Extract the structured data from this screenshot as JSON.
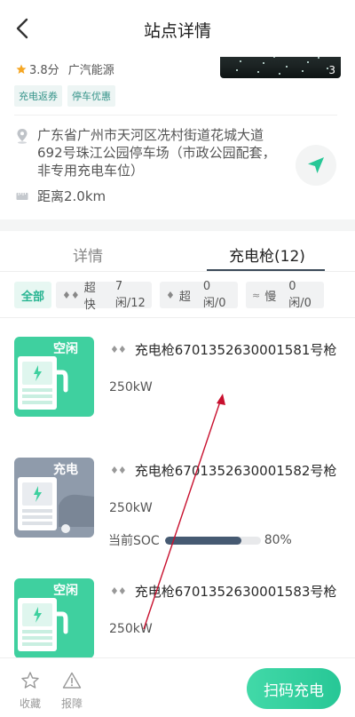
{
  "header": {
    "title": "站点详情",
    "back_icon": "chevron-left-icon"
  },
  "station": {
    "rating": "3.8分",
    "brand": "广汽能源",
    "tags": [
      "充电返券",
      "停车优惠"
    ],
    "image_count": "3",
    "address": "广东省广州市天河区冼村街道花城大道692号珠江公园停车场（市政公园配套，非专用充电车位）",
    "distance": "距离2.0km"
  },
  "tabs": [
    {
      "label": "详情",
      "active": false
    },
    {
      "label": "充电枪(12)",
      "active": true
    }
  ],
  "filters": {
    "all": "全部",
    "fast": {
      "icon": "♦♦",
      "label": "超快",
      "count": "7闲/12"
    },
    "super": {
      "icon": "♦",
      "label": "超",
      "count": "0闲/0"
    },
    "slow": {
      "icon": "≈",
      "label": "慢",
      "count": "0闲/0"
    }
  },
  "guns": [
    {
      "status": "空闲",
      "name": "充电枪6701352630001581号枪",
      "power": "250kW"
    },
    {
      "status": "充电",
      "name": "充电枪6701352630001582号枪",
      "power": "250kW",
      "soc_label": "当前SOC",
      "soc_value": "80%",
      "soc_fraction": 0.8
    },
    {
      "status": "空闲",
      "name": "充电枪6701352630001583号枪",
      "power": "250kW"
    }
  ],
  "bottom": {
    "favorite": "收藏",
    "report": "报障",
    "scan": "扫码充电"
  },
  "colors": {
    "accent": "#27c796",
    "idle_card": "#3fd09f",
    "charging_card": "#8f9bab",
    "tag_text": "#36948a",
    "soc_fill": "#465a72",
    "annotation_arrow": "#c8102e"
  }
}
